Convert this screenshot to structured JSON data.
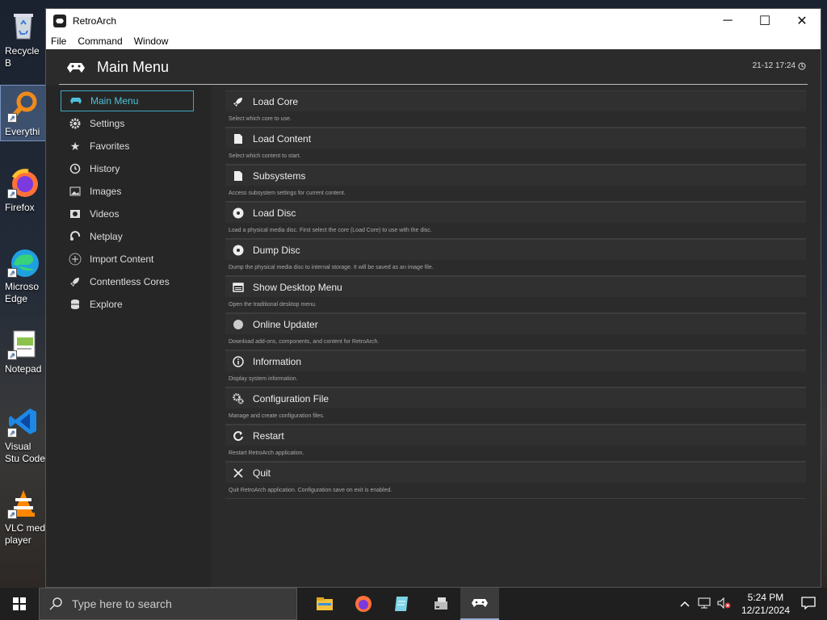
{
  "desktop": {
    "icons": [
      {
        "label": "Recycle B",
        "icon": "recycle-bin-icon"
      },
      {
        "label": "Everythi",
        "icon": "everything-search-icon"
      },
      {
        "label": "Firefox",
        "icon": "firefox-icon"
      },
      {
        "label": "Microso Edge",
        "icon": "edge-icon"
      },
      {
        "label": "Notepad",
        "icon": "notepad-icon"
      },
      {
        "label": "Visual Stu Code",
        "icon": "vscode-icon"
      },
      {
        "label": "VLC med player",
        "icon": "vlc-icon"
      }
    ]
  },
  "window": {
    "title": "RetroArch",
    "controls": {
      "minimize": "─",
      "maximize": "☐",
      "close": "✕"
    },
    "menu": [
      "File",
      "Command",
      "Window"
    ]
  },
  "retroarch": {
    "header_title": "Main Menu",
    "clock": "21-12 17:24",
    "accent_color": "#4fc0d9",
    "sidebar": [
      {
        "label": "Main Menu",
        "icon": "retroarch-icon",
        "active": true
      },
      {
        "label": "Settings",
        "icon": "gear-icon"
      },
      {
        "label": "Favorites",
        "icon": "star-icon"
      },
      {
        "label": "History",
        "icon": "history-icon"
      },
      {
        "label": "Images",
        "icon": "image-icon"
      },
      {
        "label": "Videos",
        "icon": "video-icon"
      },
      {
        "label": "Netplay",
        "icon": "netplay-icon"
      },
      {
        "label": "Import Content",
        "icon": "plus-circle-icon"
      },
      {
        "label": "Contentless Cores",
        "icon": "rocket-icon"
      },
      {
        "label": "Explore",
        "icon": "database-icon"
      }
    ],
    "entries": [
      {
        "label": "Load Core",
        "icon": "rocket-icon",
        "desc": "Select which core to use."
      },
      {
        "label": "Load Content",
        "icon": "file-icon",
        "desc": "Select which content to start."
      },
      {
        "label": "Subsystems",
        "icon": "file-icon",
        "desc": "Access subsystem settings for current content."
      },
      {
        "label": "Load Disc",
        "icon": "disc-icon",
        "desc": "Load a physical media disc. First select the core (Load Core) to use with the disc."
      },
      {
        "label": "Dump Disc",
        "icon": "disc-icon",
        "desc": "Dump the physical media disc to internal storage. It will be saved as an image file."
      },
      {
        "label": "Show Desktop Menu",
        "icon": "desktop-menu-icon",
        "desc": "Open the traditional desktop menu."
      },
      {
        "label": "Online Updater",
        "icon": "globe-icon",
        "desc": "Download add-ons, components, and content for RetroArch."
      },
      {
        "label": "Information",
        "icon": "info-icon",
        "desc": "Display system information."
      },
      {
        "label": "Configuration File",
        "icon": "config-icon",
        "desc": "Manage and create configuration files."
      },
      {
        "label": "Restart",
        "icon": "restart-icon",
        "desc": "Restart RetroArch application."
      },
      {
        "label": "Quit",
        "icon": "close-icon",
        "desc": "Quit RetroArch application. Configuration save on exit is enabled."
      }
    ]
  },
  "taskbar": {
    "search_placeholder": "Type here to search",
    "apps": [
      "file-explorer-icon",
      "firefox-icon",
      "notepad-icon",
      "drive-icon",
      "retroarch-icon"
    ],
    "time": "5:24 PM",
    "date": "12/21/2024"
  }
}
